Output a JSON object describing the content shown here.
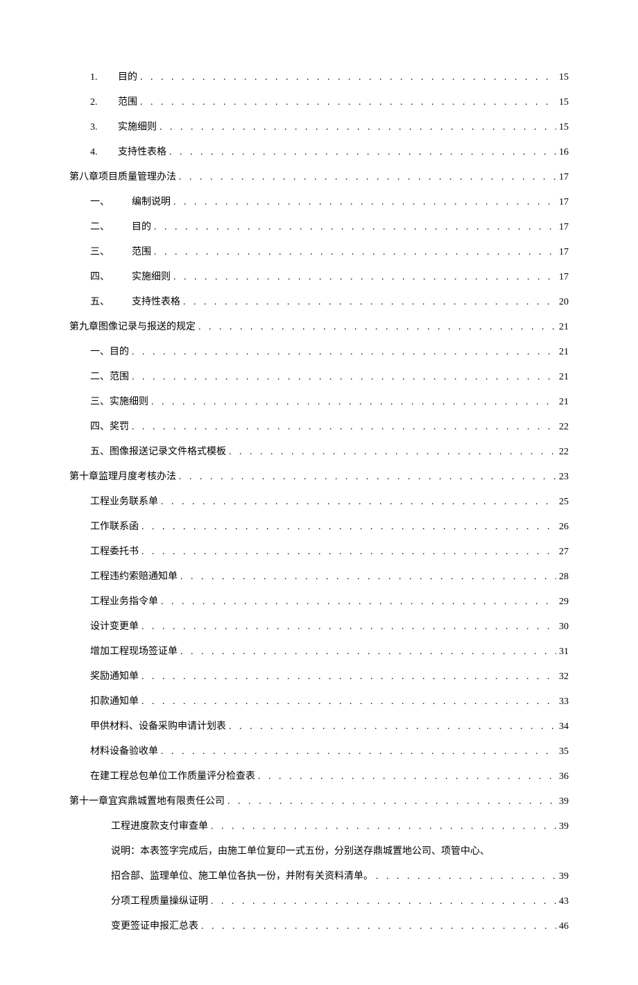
{
  "toc": [
    {
      "indent": "indent-1",
      "label": "1.",
      "labelClass": "num-col",
      "title": "目的",
      "page": "15"
    },
    {
      "indent": "indent-1",
      "label": "2.",
      "labelClass": "num-col",
      "title": "范围",
      "page": "15"
    },
    {
      "indent": "indent-1",
      "label": "3.",
      "labelClass": "num-col",
      "title": "实施细则",
      "page": "15"
    },
    {
      "indent": "indent-1",
      "label": "4.",
      "labelClass": "num-col",
      "title": "支持性表格",
      "page": "16"
    },
    {
      "indent": "indent-0",
      "label": "",
      "labelClass": "",
      "title": "第八章项目质量管理办法",
      "page": "17"
    },
    {
      "indent": "indent-1",
      "label": "一、",
      "labelClass": "num-col-wide",
      "title": "编制说明",
      "page": "17"
    },
    {
      "indent": "indent-1",
      "label": "二、",
      "labelClass": "num-col-wide",
      "title": "目的",
      "page": "17"
    },
    {
      "indent": "indent-1",
      "label": "三、",
      "labelClass": "num-col-wide",
      "title": "范围",
      "page": "17"
    },
    {
      "indent": "indent-1",
      "label": "四、",
      "labelClass": "num-col-wide",
      "title": "实施细则",
      "page": "17"
    },
    {
      "indent": "indent-1",
      "label": "五、",
      "labelClass": "num-col-wide",
      "title": "支持性表格",
      "page": "20"
    },
    {
      "indent": "indent-0",
      "label": "",
      "labelClass": "",
      "title": "第九章图像记录与报送的规定",
      "page": "21"
    },
    {
      "indent": "indent-1",
      "label": "",
      "labelClass": "",
      "title": "一、目的",
      "page": "21"
    },
    {
      "indent": "indent-1",
      "label": "",
      "labelClass": "",
      "title": "二、范围",
      "page": "21"
    },
    {
      "indent": "indent-1",
      "label": "",
      "labelClass": "",
      "title": "三、实施细则",
      "page": "21"
    },
    {
      "indent": "indent-1",
      "label": "",
      "labelClass": "",
      "title": "四、奖罚",
      "page": "22"
    },
    {
      "indent": "indent-1",
      "label": "",
      "labelClass": "",
      "title": "五、图像报送记录文件格式模板",
      "page": "22"
    },
    {
      "indent": "indent-0",
      "label": "",
      "labelClass": "",
      "title": "第十章监理月度考核办法",
      "page": "23"
    },
    {
      "indent": "indent-1",
      "label": "",
      "labelClass": "",
      "title": "工程业务联系单",
      "page": "25"
    },
    {
      "indent": "indent-1",
      "label": "",
      "labelClass": "",
      "title": "工作联系函",
      "page": "26"
    },
    {
      "indent": "indent-1",
      "label": "",
      "labelClass": "",
      "title": "工程委托书",
      "page": "27"
    },
    {
      "indent": "indent-1",
      "label": "",
      "labelClass": "",
      "title": "工程违约索赔通知单",
      "page": "28"
    },
    {
      "indent": "indent-1",
      "label": "",
      "labelClass": "",
      "title": "工程业务指令单",
      "page": "29"
    },
    {
      "indent": "indent-1",
      "label": "",
      "labelClass": "",
      "title": "设计变更单",
      "page": "30"
    },
    {
      "indent": "indent-1",
      "label": "",
      "labelClass": "",
      "title": "增加工程现场签证单",
      "page": "31"
    },
    {
      "indent": "indent-1",
      "label": "",
      "labelClass": "",
      "title": "奖励通知单",
      "page": "32"
    },
    {
      "indent": "indent-1",
      "label": "",
      "labelClass": "",
      "title": "扣款通知单",
      "page": "33"
    },
    {
      "indent": "indent-1",
      "label": "",
      "labelClass": "",
      "title": "甲供材料、设备采购申请计划表",
      "page": "34"
    },
    {
      "indent": "indent-1",
      "label": "",
      "labelClass": "",
      "title": "材料设备验收单",
      "page": "35"
    },
    {
      "indent": "indent-1",
      "label": "",
      "labelClass": "",
      "title": "在建工程总包单位工作质量评分检查表",
      "page": "36"
    },
    {
      "indent": "indent-0",
      "label": "",
      "labelClass": "",
      "title": "第十一章宜宾鼎城置地有限责任公司",
      "page": "39"
    },
    {
      "indent": "indent-2",
      "label": "",
      "labelClass": "",
      "title": "工程进度款支付审查单",
      "page": "39"
    },
    {
      "indent": "indent-2",
      "label": "",
      "labelClass": "",
      "title": "说明：本表签字完成后，由施工单位复印一式五份，分别送存鼎城置地公司、项管中心、",
      "page": "",
      "noteOnly": true
    },
    {
      "indent": "indent-2",
      "label": "",
      "labelClass": "",
      "title": "招合部、监理单位、施工单位各执一份，并附有关资料清单。",
      "page": "39"
    },
    {
      "indent": "indent-2",
      "label": "",
      "labelClass": "",
      "title": "分项工程质量操纵证明",
      "page": "43"
    },
    {
      "indent": "indent-2",
      "label": "",
      "labelClass": "",
      "title": "变更签证申报汇总表",
      "page": "46"
    }
  ]
}
